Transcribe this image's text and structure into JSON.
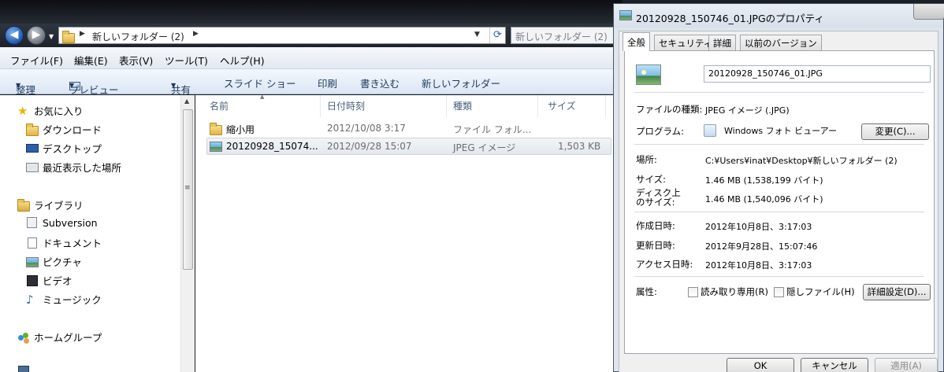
{
  "explorer": {
    "address": {
      "crumb": "新しいフォルダー (2)"
    },
    "search": {
      "placeholder": "新しいフォルダー (2)"
    },
    "menu": [
      "ファイル(F)",
      "編集(E)",
      "表示(V)",
      "ツール(T)",
      "ヘルプ(H)"
    ],
    "toolbar": {
      "organize": "整理",
      "preview": "プレビュー",
      "share": "共有",
      "slideshow": "スライド ショー",
      "print": "印刷",
      "burn": "書き込む",
      "new_folder": "新しいフォルダー"
    },
    "nav": {
      "favorites": "お気に入り",
      "downloads": "ダウンロード",
      "desktop": "デスクトップ",
      "recent": "最近表示した場所",
      "libraries": "ライブラリ",
      "subversion": "Subversion",
      "documents": "ドキュメント",
      "pictures": "ピクチャ",
      "videos": "ビデオ",
      "music": "ミュージック",
      "homegroup": "ホームグループ"
    },
    "columns": {
      "name": "名前",
      "date": "日付時刻",
      "type": "種類",
      "size": "サイズ"
    },
    "files": [
      {
        "name": "縮小用",
        "date": "2012/10/08 3:17",
        "type": "ファイル フォル...",
        "size": ""
      },
      {
        "name": "20120928_15074...",
        "date": "2012/09/28 15:07",
        "type": "JPEG イメージ",
        "size": "1,503 KB"
      }
    ]
  },
  "dialog": {
    "title": "20120928_150746_01.JPGのプロパティ",
    "tabs": [
      "全般",
      "セキュリティ",
      "詳細",
      "以前のバージョン"
    ],
    "filename": "20120928_150746_01.JPG",
    "rows": {
      "filetype_label": "ファイルの種類:",
      "filetype_value": "JPEG イメージ (.JPG)",
      "program_label": "プログラム:",
      "program_value": "Windows フォト ビューアー",
      "change_button": "変更(C)...",
      "location_label": "場所:",
      "location_value": "C:¥Users¥inat¥Desktop¥新しいフォルダー (2)",
      "size_label": "サイズ:",
      "size_value": "1.46 MB (1,538,199 バイト)",
      "disksize_label_1": "ディスク上",
      "disksize_label_2": "のサイズ:",
      "disksize_value": "1.46 MB (1,540,096 バイト)",
      "created_label": "作成日時:",
      "created_value": "2012年10月8日、3:17:03",
      "modified_label": "更新日時:",
      "modified_value": "2012年9月28日、15:07:46",
      "accessed_label": "アクセス日時:",
      "accessed_value": "2012年10月8日、3:17:03",
      "attributes_label": "属性:",
      "readonly": "読み取り専用(R)",
      "hidden": "隠しファイル(H)",
      "advanced_button": "詳細設定(D)..."
    },
    "buttons": {
      "ok": "OK",
      "cancel": "キャンセル",
      "apply": "適用(A)"
    }
  }
}
